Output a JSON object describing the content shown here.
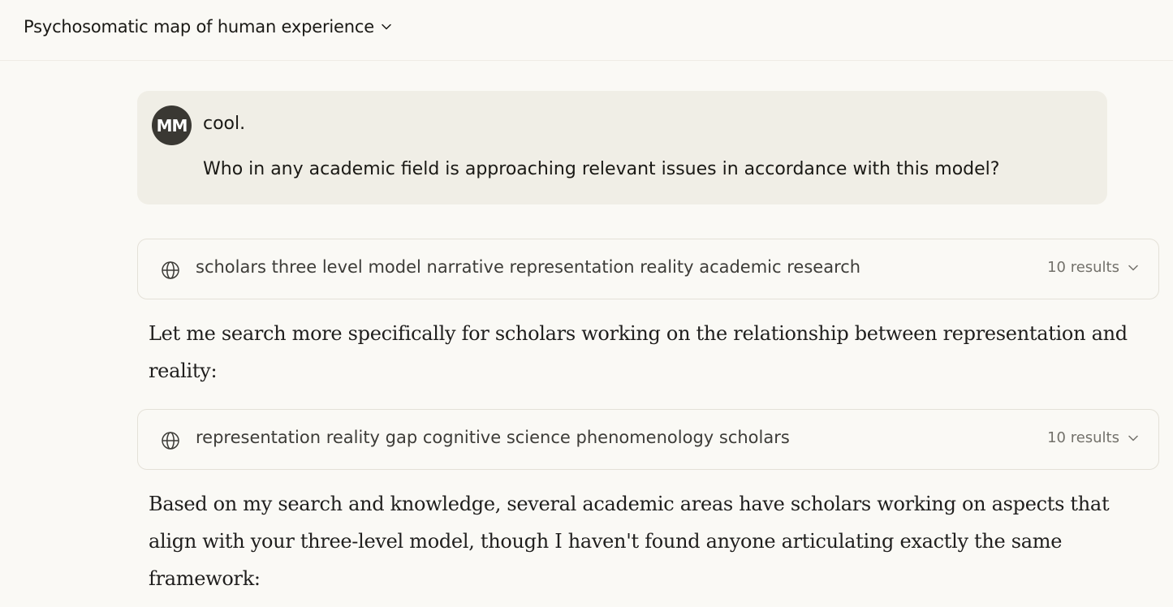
{
  "header": {
    "conversation_title": "Psychosomatic map of human experience",
    "title_icon": "chevron-down-icon"
  },
  "user_message": {
    "avatar_initials": "MM",
    "line1": "cool.",
    "line2": "Who in any academic field is approaching relevant issues in accordance with this model?"
  },
  "searches": [
    {
      "icon": "globe-icon",
      "query": "scholars three level model narrative representation reality academic research",
      "results_label": "10 results"
    },
    {
      "icon": "globe-icon",
      "query": "representation reality gap cognitive science phenomenology scholars",
      "results_label": "10 results"
    }
  ],
  "assistant": {
    "paragraph1": "Let me search more specifically for scholars working on the relationship between representation and reality:",
    "paragraph2": "Based on my search and knowledge, several academic areas have scholars working on aspects that align with your three-level model, though I haven't found anyone articulating exactly the same framework:"
  },
  "colors": {
    "background": "#faf9f5",
    "user_bubble": "#f0eee6",
    "avatar": "#3a3833",
    "card_border": "#e4e1d8"
  }
}
